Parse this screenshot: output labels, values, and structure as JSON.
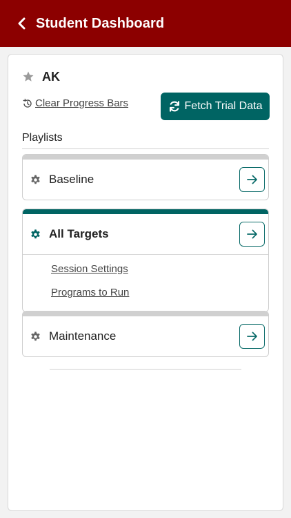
{
  "header": {
    "title": "Student Dashboard",
    "back_icon": "chevron-left-icon",
    "background": "#8c0000"
  },
  "student": {
    "initials": "AK",
    "star_icon": "star-icon"
  },
  "actions": {
    "clear_progress_label": "Clear Progress Bars",
    "clear_icon": "history-icon",
    "fetch_label": "Fetch Trial Data",
    "fetch_icon": "refresh-icon",
    "accent": "#006463"
  },
  "playlists": {
    "label": "Playlists",
    "items": [
      {
        "name": "Baseline",
        "active": false
      },
      {
        "name": "All Targets",
        "active": true,
        "links": [
          "Session Settings",
          "Programs to Run"
        ]
      },
      {
        "name": "Maintenance",
        "active": false
      }
    ]
  }
}
